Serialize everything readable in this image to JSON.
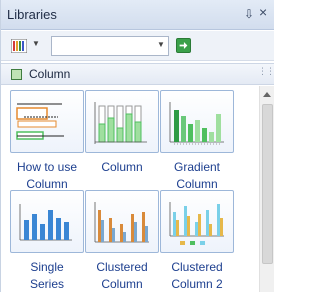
{
  "panel": {
    "title": "Libraries",
    "pin_glyph": "⇩",
    "close_glyph": "×"
  },
  "toolbar": {
    "library_icon": "library-color-icon",
    "search_value": "",
    "go_icon": "go-arrow-icon"
  },
  "group": {
    "label": "Column",
    "icon": "column-group-icon"
  },
  "tiles": [
    {
      "label_line1": "How to use",
      "label_line2": "Column"
    },
    {
      "label_line1": "Column",
      "label_line2": ""
    },
    {
      "label_line1": "Gradient",
      "label_line2": "Column"
    },
    {
      "label_line1": "Single",
      "label_line2": "Series"
    },
    {
      "label_line1": "Clustered",
      "label_line2": "Column"
    },
    {
      "label_line1": "Clustered",
      "label_line2": "Column 2"
    }
  ],
  "colors": {
    "accent_blue": "#1d3f8f",
    "green": "#4fbf5f",
    "orange": "#e68a2e"
  }
}
